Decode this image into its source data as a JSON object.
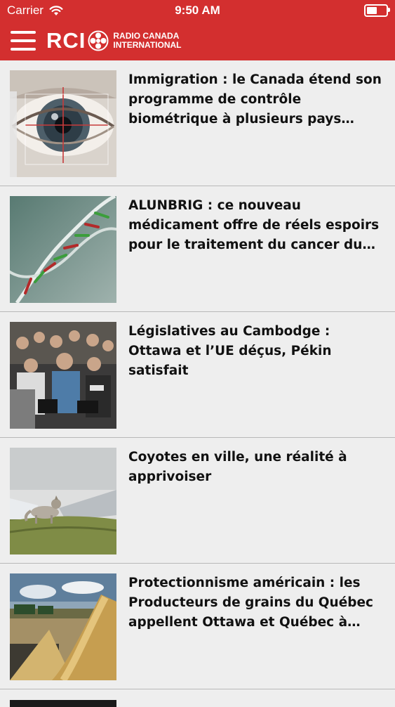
{
  "status_bar": {
    "carrier": "Carrier",
    "time": "9:50 AM"
  },
  "header": {
    "logo_text": "RCI",
    "logo_sub_line1": "RADIO CANADA",
    "logo_sub_line2": "INTERNATIONAL",
    "brand_color": "#d32f2f"
  },
  "articles": [
    {
      "title": "Immigration : le Canada étend son programme de contrôle biométrique à plusieurs pays étra...",
      "thumbnail": "eye-biometric-photo"
    },
    {
      "title": "ALUNBRIG : ce nouveau médicament offre de réels espoirs pour le traitement du cancer du p...",
      "thumbnail": "dna-helix-photo"
    },
    {
      "title": "Législatives au Cambodge : Ottawa et l’UE déçus, Pékin satisfait",
      "thumbnail": "press-crowd-photo"
    },
    {
      "title": "Coyotes en ville, une réalité à apprivoiser",
      "thumbnail": "coyote-photo"
    },
    {
      "title": "Protectionnisme américain : les Producteurs de grains du Québec appellent Ottawa et Québec à l’aide",
      "thumbnail": "grain-harvest-photo"
    }
  ]
}
